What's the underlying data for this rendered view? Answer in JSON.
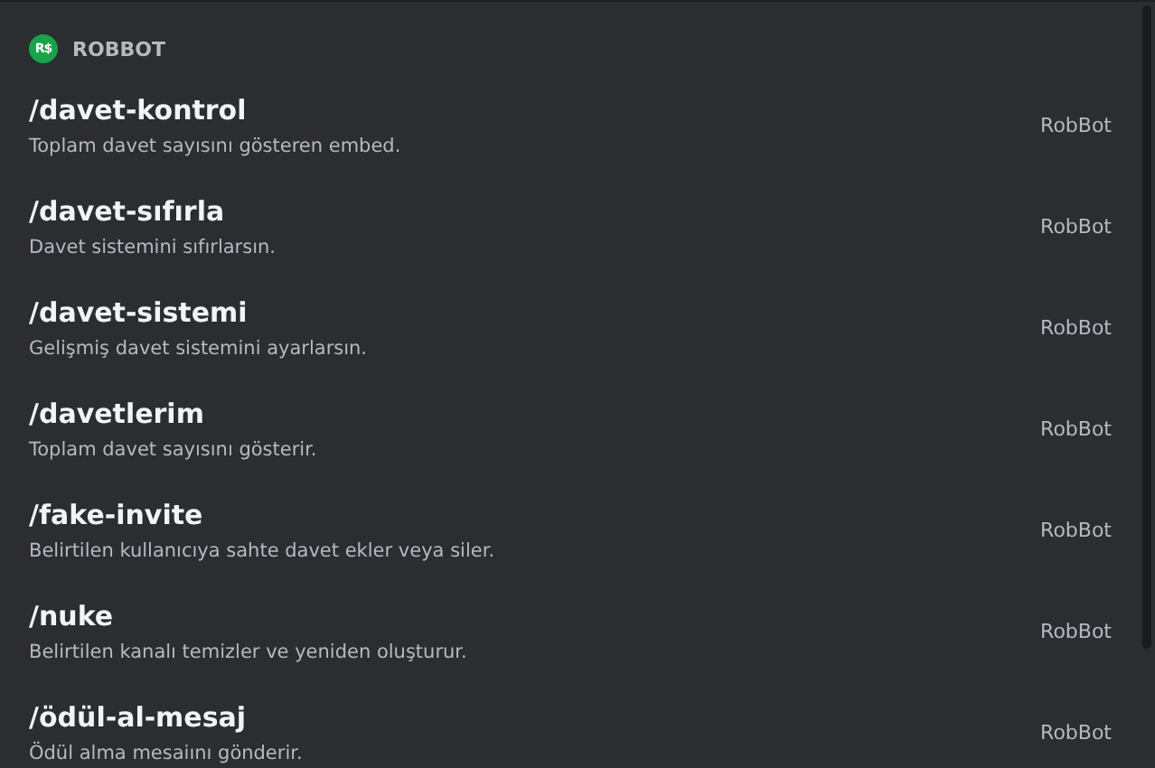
{
  "app": {
    "icon_text": "R$",
    "name": "ROBBOT"
  },
  "commands": [
    {
      "name": "/davet-kontrol",
      "description": "Toplam davet sayısını gösteren embed.",
      "source": "RobBot"
    },
    {
      "name": "/davet-sıfırla",
      "description": "Davet sistemini sıfırlarsın.",
      "source": "RobBot"
    },
    {
      "name": "/davet-sistemi",
      "description": "Gelişmiş davet sistemini ayarlarsın.",
      "source": "RobBot"
    },
    {
      "name": "/davetlerim",
      "description": "Toplam davet sayısını gösterir.",
      "source": "RobBot"
    },
    {
      "name": "/fake-invite",
      "description": "Belirtilen kullanıcıya sahte davet ekler veya siler.",
      "source": "RobBot"
    },
    {
      "name": "/nuke",
      "description": "Belirtilen kanalı temizler ve yeniden oluşturur.",
      "source": "RobBot"
    },
    {
      "name": "/ödül-al-mesaj",
      "description": "Ödül alma mesaiını gönderir.",
      "source": "RobBot"
    }
  ]
}
